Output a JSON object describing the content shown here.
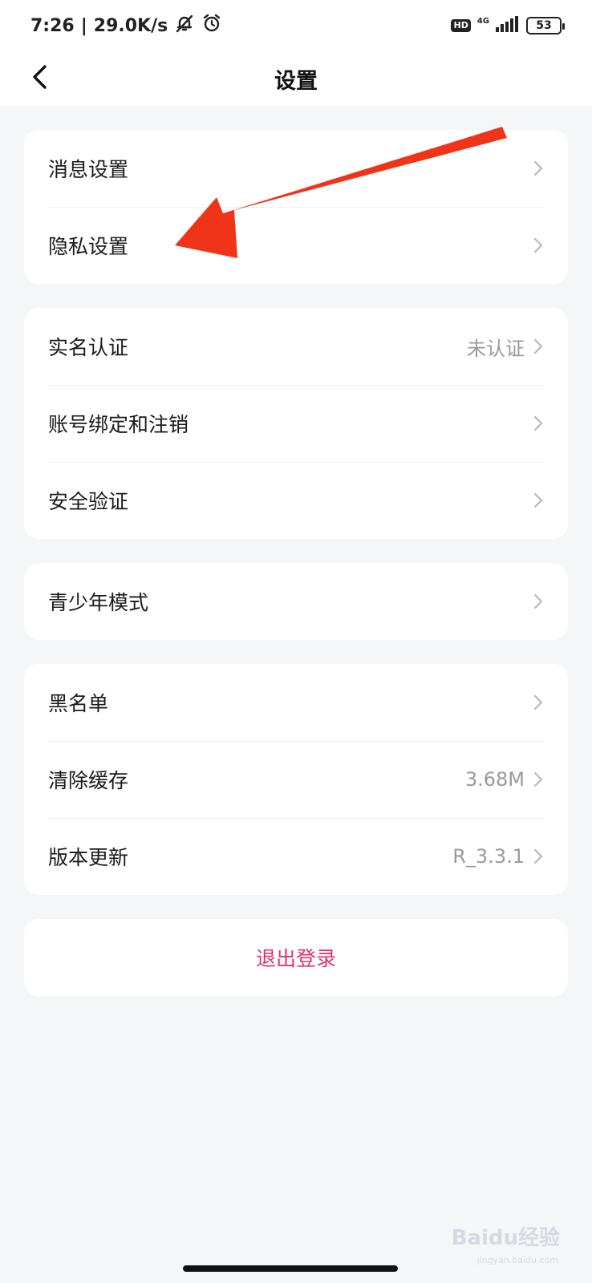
{
  "status_bar": {
    "time": "7:26",
    "separator": "|",
    "net_speed": "29.0K/s",
    "hd_label": "HD",
    "network_label": "4G",
    "battery_level": "53"
  },
  "header": {
    "title": "设置"
  },
  "groups": [
    {
      "items": [
        {
          "label": "消息设置",
          "value": ""
        },
        {
          "label": "隐私设置",
          "value": ""
        }
      ]
    },
    {
      "items": [
        {
          "label": "实名认证",
          "value": "未认证"
        },
        {
          "label": "账号绑定和注销",
          "value": ""
        },
        {
          "label": "安全验证",
          "value": ""
        }
      ]
    },
    {
      "items": [
        {
          "label": "青少年模式",
          "value": ""
        }
      ]
    },
    {
      "items": [
        {
          "label": "黑名单",
          "value": ""
        },
        {
          "label": "清除缓存",
          "value": "3.68M"
        },
        {
          "label": "版本更新",
          "value": "R_3.3.1"
        }
      ]
    }
  ],
  "logout": {
    "label": "退出登录"
  },
  "watermark": {
    "brand": "Baidu经验",
    "url": "jingyan.baidu.com"
  },
  "colors": {
    "logout": "#e0336a",
    "annotation_arrow": "#f0341a",
    "secondary_text": "#9a9a9a"
  }
}
